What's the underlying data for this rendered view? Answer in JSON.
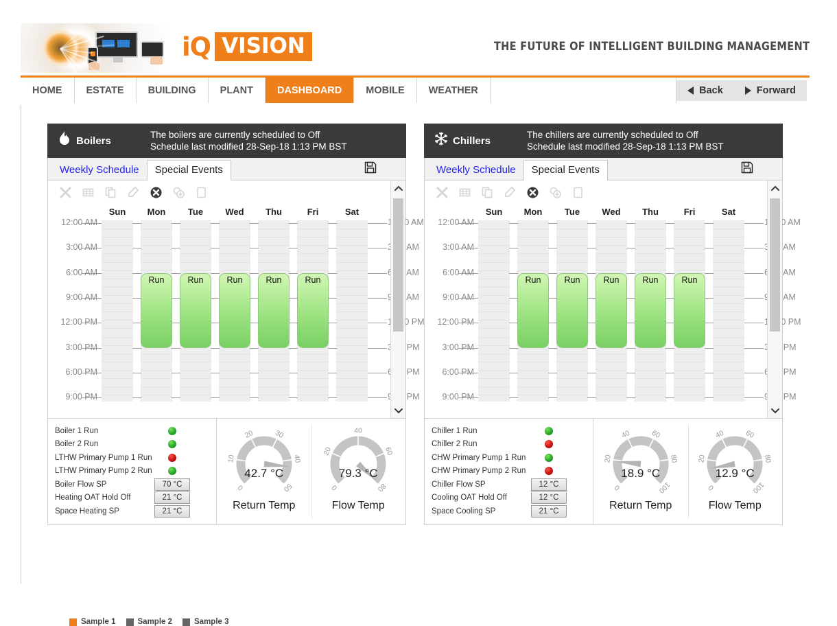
{
  "branding": {
    "logo_iq": "iQ",
    "logo_vision": "VISION",
    "tagline": "THE FUTURE OF INTELLIGENT BUILDING MANAGEMENT",
    "accent_color": "#ee7f1a"
  },
  "nav": {
    "items": [
      {
        "label": "HOME",
        "active": false
      },
      {
        "label": "ESTATE",
        "active": false
      },
      {
        "label": "BUILDING",
        "active": false
      },
      {
        "label": "PLANT",
        "active": false
      },
      {
        "label": "DASHBOARD",
        "active": true
      },
      {
        "label": "MOBILE",
        "active": false
      },
      {
        "label": "WEATHER",
        "active": false
      }
    ],
    "back_label": "Back",
    "forward_label": "Forward"
  },
  "toolbar_icons": [
    {
      "name": "delete-icon",
      "glyph": "✕",
      "active": false
    },
    {
      "name": "grid-icon",
      "glyph": "▦",
      "active": false
    },
    {
      "name": "copy-icon",
      "glyph": "❐",
      "active": false
    },
    {
      "name": "eraser-icon",
      "glyph": "▰",
      "active": false
    },
    {
      "name": "cancel-circle-icon",
      "glyph": "✖",
      "active": true
    },
    {
      "name": "add-circle-icon",
      "glyph": "⊕",
      "active": false
    },
    {
      "name": "paste-icon",
      "glyph": "☐",
      "active": false
    }
  ],
  "schedule": {
    "days": [
      "Sun",
      "Mon",
      "Tue",
      "Wed",
      "Thu",
      "Fri",
      "Sat"
    ],
    "time_labels": [
      "12:00 AM",
      "3:00 AM",
      "6:00 AM",
      "9:00 AM",
      "12:00 PM",
      "3:00 PM",
      "6:00 PM",
      "9:00 PM"
    ],
    "run_label": "Run",
    "run_days": [
      "Mon",
      "Tue",
      "Wed",
      "Thu",
      "Fri"
    ],
    "run_start": "6:00 AM",
    "run_end": "3:00 PM",
    "run_color_top": "#d2f5b4",
    "run_color_bottom": "#79cf64"
  },
  "boilers": {
    "title": "Boilers",
    "icon": "flame-icon",
    "status_line_1": "The boilers are currently scheduled to Off",
    "status_line_2": "Schedule last modified 28-Sep-18 1:13 PM BST",
    "tabs": [
      {
        "label": "Weekly Schedule",
        "active": true
      },
      {
        "label": "Special Events",
        "active": false
      }
    ],
    "save_icon": "save-disk-icon",
    "points": [
      {
        "label": "Boiler 1 Run",
        "type": "led",
        "state": "on"
      },
      {
        "label": "Boiler 2 Run",
        "type": "led",
        "state": "on"
      },
      {
        "label": "LTHW Primary Pump 1 Run",
        "type": "led",
        "state": "off"
      },
      {
        "label": "LTHW Primary Pump 2 Run",
        "type": "led",
        "state": "on"
      },
      {
        "label": "Boiler Flow SP",
        "type": "value",
        "value": "70 °C"
      },
      {
        "label": "Heating OAT Hold Off",
        "type": "value",
        "value": "21 °C"
      },
      {
        "label": "Space Heating SP",
        "type": "value",
        "value": "21 °C"
      }
    ],
    "gauges": [
      {
        "label": "Return Temp",
        "value": 42.7,
        "display": "42.7 °C",
        "min": 0,
        "max": 50,
        "ticks": [
          "0",
          "10",
          "20",
          "30",
          "40",
          "50"
        ]
      },
      {
        "label": "Flow Temp",
        "value": 79.3,
        "display": "79.3 °C",
        "min": 0,
        "max": 80,
        "ticks": [
          "0",
          "20",
          "40",
          "60",
          "80"
        ]
      }
    ]
  },
  "chillers": {
    "title": "Chillers",
    "icon": "snowflake-icon",
    "status_line_1": "The chillers are currently scheduled to Off",
    "status_line_2": "Schedule last modified 28-Sep-18 1:13 PM BST",
    "tabs": [
      {
        "label": "Weekly Schedule",
        "active": true
      },
      {
        "label": "Special Events",
        "active": false
      }
    ],
    "save_icon": "save-disk-icon",
    "points": [
      {
        "label": "Chiller 1 Run",
        "type": "led",
        "state": "on"
      },
      {
        "label": "Chiller 2 Run",
        "type": "led",
        "state": "off"
      },
      {
        "label": "CHW Primary Pump 1 Run",
        "type": "led",
        "state": "on"
      },
      {
        "label": "CHW Primary Pump 2 Run",
        "type": "led",
        "state": "off"
      },
      {
        "label": "Chiller Flow SP",
        "type": "value",
        "value": "12 °C"
      },
      {
        "label": "Cooling OAT Hold Off",
        "type": "value",
        "value": "12 °C"
      },
      {
        "label": "Space Cooling SP",
        "type": "value",
        "value": "21 °C"
      }
    ],
    "gauges": [
      {
        "label": "Return Temp",
        "value": 18.9,
        "display": "18.9 °C",
        "min": 0,
        "max": 100,
        "ticks": [
          "0",
          "20",
          "40",
          "60",
          "80",
          "100"
        ]
      },
      {
        "label": "Flow Temp",
        "value": 12.9,
        "display": "12.9 °C",
        "min": 0,
        "max": 100,
        "ticks": [
          "0",
          "20",
          "40",
          "60",
          "80",
          "100"
        ]
      }
    ]
  },
  "legend": [
    {
      "label": "Sample 1",
      "color": "#ee7f1a"
    },
    {
      "label": "Sample 2",
      "color": "#666666"
    },
    {
      "label": "Sample 3",
      "color": "#666666"
    }
  ]
}
